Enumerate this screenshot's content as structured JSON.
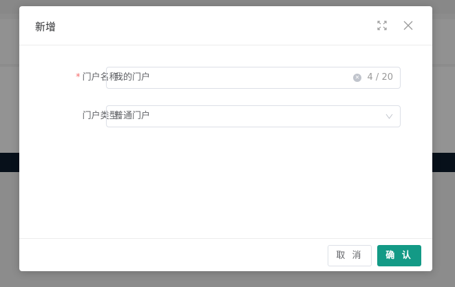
{
  "dialog": {
    "title": "新增",
    "fullscreen_icon": "fullscreen-icon",
    "close_icon": "close-icon"
  },
  "form": {
    "name": {
      "label": "门户名称:",
      "required_mark": "*",
      "value": "我的门户",
      "counter": "4 / 20"
    },
    "type": {
      "label": "门户类型:",
      "value": "普通门户"
    }
  },
  "footer": {
    "cancel": "取 消",
    "confirm": "确 认"
  }
}
